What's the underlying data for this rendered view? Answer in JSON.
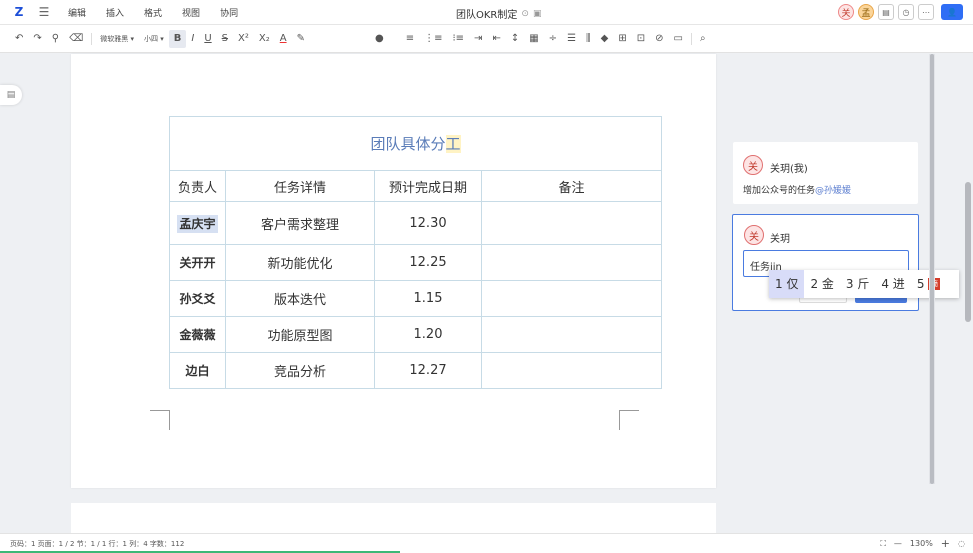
{
  "menubar": {
    "logo": "Z",
    "items": [
      "编辑",
      "插入",
      "格式",
      "视图",
      "协同"
    ],
    "doc_title": "团队OKR制定",
    "avatars": [
      "关",
      "孟"
    ],
    "share_label": "A",
    "colors": {
      "accent": "#2f6ef5"
    }
  },
  "toolbar": {
    "font_name": "微软雅黑",
    "font_size": "小四",
    "bold": "B",
    "italic": "I",
    "underline": "U",
    "strike": "S",
    "superscript": "X²",
    "subscript": "X₂",
    "font_color": "A"
  },
  "table": {
    "title_prefix": "团队具体分",
    "title_highlight": "工",
    "headers": [
      "负责人",
      "任务详情",
      "预计完成日期",
      "备注"
    ],
    "rows": [
      {
        "name": "孟庆宇",
        "task": "客户需求整理",
        "date": "12.30",
        "note": ""
      },
      {
        "name": "关开开",
        "task": "新功能优化",
        "date": "12.25",
        "note": ""
      },
      {
        "name": "孙爻爻",
        "task": "版本迭代",
        "date": "1.15",
        "note": ""
      },
      {
        "name": "金薇薇",
        "task": "功能原型图",
        "date": "1.20",
        "note": ""
      },
      {
        "name": "边白",
        "task": "竞品分析",
        "date": "12.27",
        "note": ""
      }
    ]
  },
  "comments": {
    "first": {
      "avatar": "关",
      "author": "关玥(我)",
      "text_prefix": "增加公众号的任务",
      "mention": "@孙媛媛"
    },
    "second": {
      "avatar": "关",
      "author": "关玥",
      "input_value": "任务jin"
    }
  },
  "ime": {
    "candidates": [
      "1 仅",
      "2 金",
      "3 斤",
      "4 进",
      "5"
    ]
  },
  "statusbar": {
    "info": "页码：1  页面：1 / 2    节：1 / 1  行：1  列：4  字数：112",
    "zoom": "130%",
    "minus": "—",
    "plus": "+"
  }
}
